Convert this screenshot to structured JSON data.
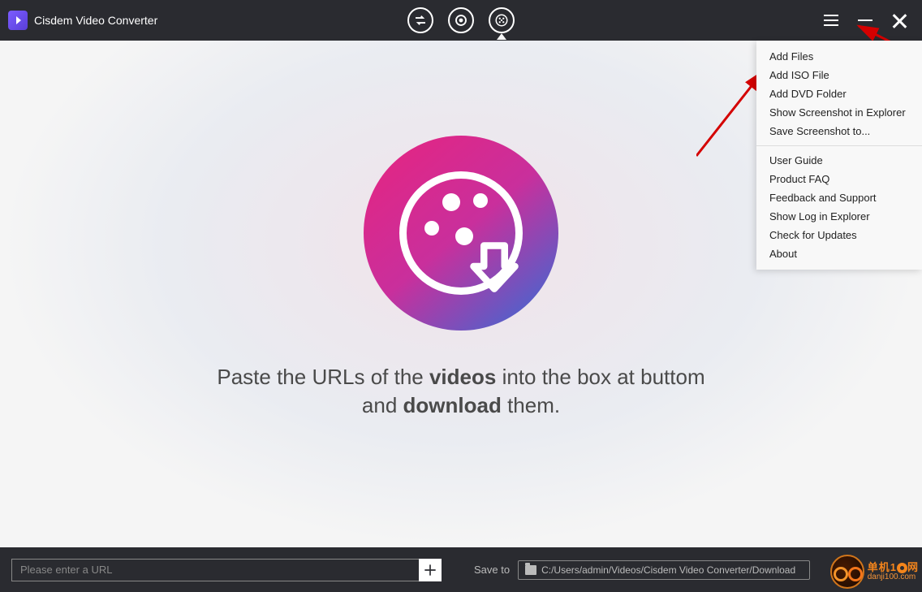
{
  "app": {
    "title": "Cisdem Video Converter"
  },
  "hint": {
    "line1_a": "Paste the URLs of the ",
    "line1_b": "videos",
    "line1_c": " into the box at buttom",
    "line2_a": "and ",
    "line2_b": "download",
    "line2_c": " them."
  },
  "footer": {
    "url_placeholder": "Please enter a URL",
    "save_label": "Save to",
    "save_path": "C:/Users/admin/Videos/Cisdem Video Converter/Download"
  },
  "menu": {
    "group1": [
      "Add Files",
      "Add ISO File",
      "Add DVD Folder",
      "Show Screenshot in Explorer",
      "Save Screenshot to..."
    ],
    "group2": [
      "User Guide",
      "Product FAQ",
      "Feedback and Support",
      "Show Log in Explorer",
      "Check for Updates",
      "About"
    ]
  },
  "watermark": {
    "brand": "单机1",
    "brand_suffix": "网",
    "url": "danji100.com"
  }
}
